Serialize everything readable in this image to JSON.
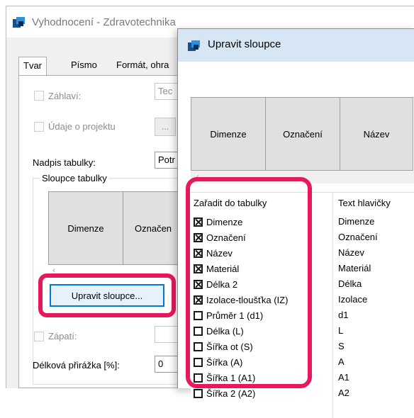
{
  "main_window": {
    "title": "Vyhodnocení - Zdravotechnika",
    "tabs": [
      "Tvar",
      "Písmo",
      "Formát, ohra"
    ],
    "header_checkbox_label": "Záhlaví:",
    "header_field_value": "Tec",
    "project_checkbox_label": "Údaje o projektu",
    "project_button_label": "...",
    "caption_label": "Nadpis tabulky:",
    "caption_field_value": "Potr",
    "columns_group_label": "Sloupce tabulky",
    "preview_columns": [
      "Dimenze",
      "Označen"
    ],
    "edit_columns_button": "Upravit sloupce...",
    "footer_checkbox_label": "Zápatí:",
    "length_surcharge_label": "Délková přirážka [%]:",
    "length_surcharge_value": "0"
  },
  "dialog": {
    "title": "Upravit sloupce",
    "preview_columns": [
      "Dimenze",
      "Označení",
      "Název"
    ],
    "grid_headers": [
      "Zařadit do tabulky",
      "Text hlavičky"
    ],
    "rows": [
      {
        "name": "Dimenze",
        "header": "Dimenze",
        "checked": true
      },
      {
        "name": "Označení",
        "header": "Označení",
        "checked": true
      },
      {
        "name": "Název",
        "header": "Název",
        "checked": true
      },
      {
        "name": "Materiál",
        "header": "Materiál",
        "checked": true
      },
      {
        "name": "Délka 2",
        "header": "Délka",
        "checked": true
      },
      {
        "name": "Izolace-tloušťka (IZ)",
        "header": "Izolace",
        "checked": true
      },
      {
        "name": "Průměr 1 (d1)",
        "header": "d1",
        "checked": false
      },
      {
        "name": "Délka (L)",
        "header": "L",
        "checked": false
      },
      {
        "name": "Šířka ot (S)",
        "header": "S",
        "checked": false
      },
      {
        "name": "Šířka (A)",
        "header": "A",
        "checked": false
      },
      {
        "name": "Šířka 1 (A1)",
        "header": "A1",
        "checked": false
      },
      {
        "name": "Šířka 2 (A2)",
        "header": "A2",
        "checked": false
      }
    ]
  },
  "colors": {
    "highlight": "#e8185e",
    "focus_border": "#0078d7",
    "dialog_titlebar": "#d7e6f5"
  },
  "icons": {
    "app": "app-icon",
    "scroll_left": "chevron-left-icon"
  }
}
